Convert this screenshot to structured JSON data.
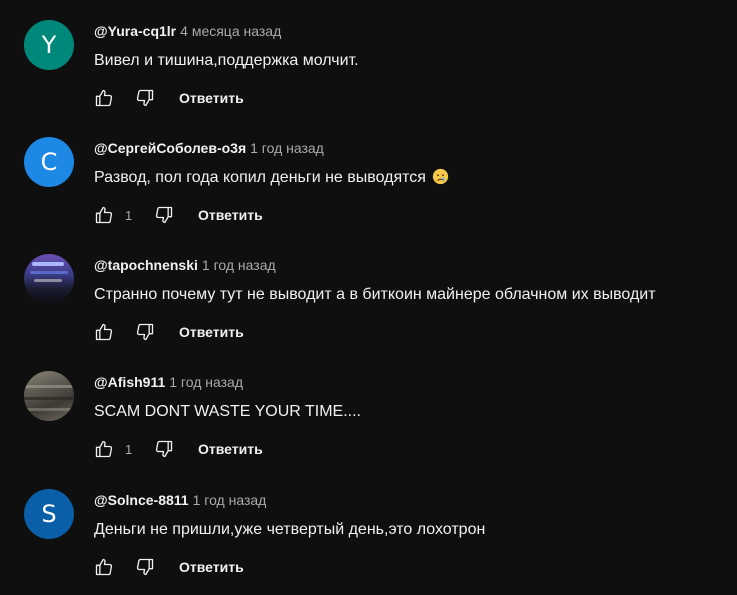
{
  "comments": [
    {
      "avatar_letter": "Y",
      "avatar_color": "#00897b",
      "author": "@Yura-cq1lr",
      "time": "4 месяца назад",
      "text": "Вивел и тишина,поддержка молчит.",
      "likes": "",
      "reply_label": "Ответить"
    },
    {
      "avatar_letter": "С",
      "avatar_color": "#1e88e5",
      "author": "@СергейСоболев-о3я",
      "time": "1 год назад",
      "text": "Развод, пол года копил деньги не выводятся",
      "emoji": "crying-face-icon",
      "likes": "1",
      "reply_label": "Ответить"
    },
    {
      "avatar_image": "tapochnenski-photo",
      "author": "@tapochnenski",
      "time": "1 год назад",
      "text": "Странно почему тут не выводит а в биткоин майнере облачном их выводит",
      "likes": "",
      "reply_label": "Ответить"
    },
    {
      "avatar_image": "afish911-photo",
      "author": "@Afish911",
      "time": "1 год назад",
      "text": "SCAM DONT WASTE YOUR TIME....",
      "likes": "1",
      "reply_label": "Ответить"
    },
    {
      "avatar_letter": "S",
      "avatar_color": "#0b5fa8",
      "author": "@Solnce-8811",
      "time": "1 год назад",
      "text": "Деньги не пришли,уже четвертый день,это лохотрон",
      "likes": "",
      "reply_label": "Ответить"
    }
  ]
}
